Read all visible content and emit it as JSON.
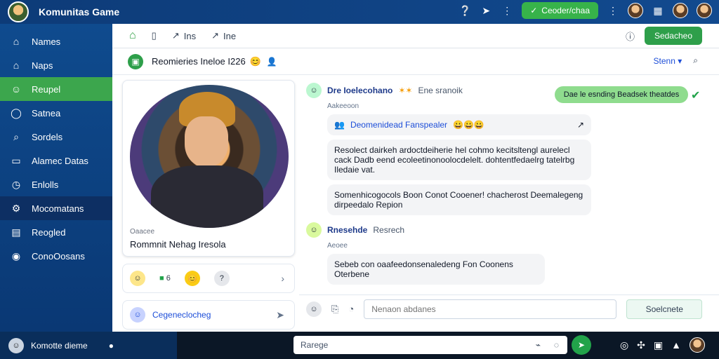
{
  "app": {
    "title": "Komunitas Game",
    "top_button": "Ceoder/chaa",
    "top_icons": [
      "help-icon",
      "share-icon",
      "more-vertical-icon"
    ],
    "right_icons": [
      "more-vertical-icon",
      "grid-icon",
      "user-icon",
      "user-icon"
    ]
  },
  "sidebar": {
    "items": [
      {
        "label": "Names",
        "icon": "home-icon",
        "active": false
      },
      {
        "label": "Naps",
        "icon": "home-icon",
        "active": false
      },
      {
        "label": "Reupel",
        "icon": "users-icon",
        "active": true
      },
      {
        "label": "Satnea",
        "icon": "chat-icon",
        "active": false
      },
      {
        "label": "Sordels",
        "icon": "search-icon",
        "active": false
      },
      {
        "label": "Alamec Datas",
        "icon": "chart-icon",
        "active": false
      },
      {
        "label": "Enlolls",
        "icon": "clock-icon",
        "active": false
      },
      {
        "label": "Mocomatans",
        "icon": "gear-icon",
        "active": false
      },
      {
        "label": "Reogled",
        "icon": "doc-icon",
        "active": false
      },
      {
        "label": "ConoOosans",
        "icon": "controller-icon",
        "active": false
      }
    ]
  },
  "toolbar": {
    "btn2": "Ins",
    "btn3": "Ine",
    "save_label": "Sedacheo"
  },
  "subbar": {
    "title": "Reomieries Ineloe I226",
    "filter": "Stenn"
  },
  "profile": {
    "small": "Oaacee",
    "title": "Rommnit Nehag Iresola"
  },
  "actions": {
    "count": "6",
    "bottom_label": "Cegeneclocheg"
  },
  "chat": {
    "messages": [
      {
        "name": "Dre Ioelecohano",
        "meta": "Ene sranoik",
        "sub": "Aakeeoon",
        "badge_text": "Deomenidead Fanspealer",
        "bubbles": [
          "Resolect dairkeh ardoctdeiherie hel cohmo kecitsltengl aurelecl cack Dadb eend ecoleetinonoolocdelelt. dohtentfedaelrg tatelrbg Iledaie vat.",
          "Somenhicogocols Boon Conot Cooener! chacherost Deemalegeng dirpeedalo Repion"
        ]
      },
      {
        "name": "Rnesehde",
        "meta": "Resrech",
        "sub": "Aeoee",
        "bubbles": [
          "Sebeb con oaafeedonsenaledeng Fon Coonens Oterbene"
        ]
      }
    ],
    "green_bubble": "Dae le esnding Beadsek theatdes",
    "composer_placeholder": "Nenaon abdanes",
    "composer_button": "Soelcnete"
  },
  "status": {
    "left_label": "Komotte dieme",
    "search_placeholder": "Rarege"
  }
}
